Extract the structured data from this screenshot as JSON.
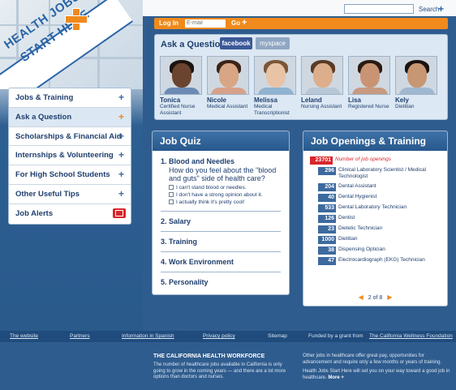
{
  "logo": {
    "line1": "HEALTH JOBS",
    "line2": "START HERE"
  },
  "topbar": {
    "search_label": "Search",
    "search_plus": "+"
  },
  "login": {
    "label": "Log In",
    "email_placeholder": "E-mail",
    "go_label": "Go",
    "go_plus": "+"
  },
  "ask": {
    "title": "Ask a Question",
    "facebook_label": "facebook",
    "myspace_label": "myspace",
    "people": [
      {
        "name": "Tonica",
        "role": "Certified Nurse Assistant"
      },
      {
        "name": "Nicole",
        "role": "Medical Assistant"
      },
      {
        "name": "Melissa",
        "role": "Medical Transcriptionist"
      },
      {
        "name": "Leland",
        "role": "Nursing Assistant"
      },
      {
        "name": "Lisa",
        "role": "Registered Nurse"
      },
      {
        "name": "Kely",
        "role": "Dietitian"
      }
    ]
  },
  "nav": {
    "items": [
      {
        "label": "Jobs & Training",
        "icon": "plus-icon"
      },
      {
        "label": "Ask a Question",
        "icon": "plus-icon"
      },
      {
        "label": "Scholarships & Financial Aid",
        "icon": "plus-icon"
      },
      {
        "label": "Internships & Volunteering",
        "icon": "plus-icon"
      },
      {
        "label": "For High School Students",
        "icon": "plus-icon"
      },
      {
        "label": "Other Useful Tips",
        "icon": "plus-icon"
      },
      {
        "label": "Job Alerts",
        "icon": "mail-icon"
      }
    ],
    "plus": "+"
  },
  "quiz": {
    "title": "Job Quiz",
    "items": [
      {
        "label": "1. Blood and Needles",
        "question": "How do you feel about the \"blood and guts\" side of health care?",
        "options": [
          "I can't stand blood or needles.",
          "I don't have a strong opinion about it.",
          "I actually think it's pretty cool!"
        ]
      },
      {
        "label": "2. Salary"
      },
      {
        "label": "3. Training"
      },
      {
        "label": "4. Work Environment"
      },
      {
        "label": "5. Personality"
      }
    ]
  },
  "openings": {
    "title": "Job Openings & Training",
    "total": {
      "count": "23701",
      "label": "Number of job openings"
    },
    "rows": [
      {
        "count": "296",
        "label": "Clinical Laboratory Scientist / Medical Technologist"
      },
      {
        "count": "204",
        "label": "Dental Assistant"
      },
      {
        "count": "40",
        "label": "Dental Hygienist"
      },
      {
        "count": "533",
        "label": "Dental Laboratory Technician"
      },
      {
        "count": "126",
        "label": "Dentist"
      },
      {
        "count": "23",
        "label": "Dietetic Technician"
      },
      {
        "count": "1000",
        "label": "Dietitian"
      },
      {
        "count": "38",
        "label": "Dispensing Optician"
      },
      {
        "count": "47",
        "label": "Electrocardiograph (EKG) Technician"
      }
    ],
    "pager": "2 of 8"
  },
  "footer": {
    "links": [
      "The website",
      "Partners",
      "Information in Spanish",
      "Privacy policy",
      "Sitemap"
    ],
    "funded_text": "Funded by a grant from",
    "funded_link": "The California Wellness Foundation",
    "title": "THE CALIFORNIA HEALTH WORKFORCE",
    "text": "The number of healthcare jobs available in California is only going to grow in the coming years — and there are a lot more options than doctors and nurses.",
    "right1": "Other jobs in healthcare offer great pay, opportunities for advancement and require only a few months or years of training.",
    "right2": "Health Jobs Start Here will set you on your way toward a good job in healthcare.",
    "more": "More +"
  }
}
